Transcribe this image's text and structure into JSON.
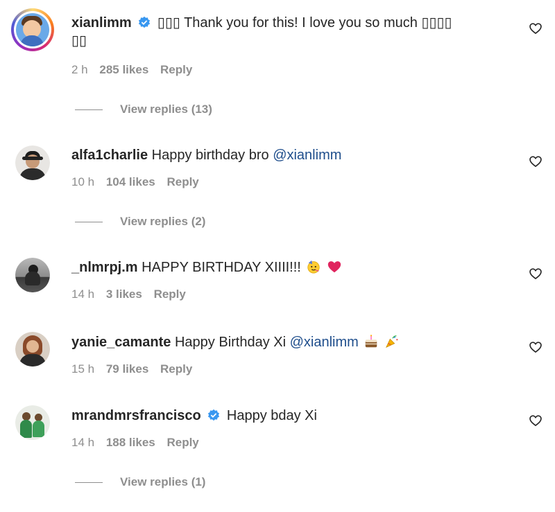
{
  "comments": [
    {
      "username": "xianlimm",
      "verified": true,
      "text": "Thank you for this! I love you so much",
      "leading_glyphs": "▯▯▯",
      "trailing_glyphs": "▯▯▯▯",
      "trailing_line2": "▯▯",
      "time": "2 h",
      "likes": "285 likes",
      "reply": "Reply",
      "view_replies": "View replies (13)"
    },
    {
      "username": "alfa1charlie",
      "text": "Happy birthday bro",
      "mention": "@xianlimm",
      "time": "10 h",
      "likes": "104 likes",
      "reply": "Reply",
      "view_replies": "View replies (2)"
    },
    {
      "username": "_nlmrpj.m",
      "text": "HAPPY BIRTHDAY XIIII!!!",
      "emojis": [
        "partying-face-emoji",
        "red-heart-emoji"
      ],
      "time": "14 h",
      "likes": "3 likes",
      "reply": "Reply"
    },
    {
      "username": "yanie_camante",
      "text": "Happy Birthday Xi",
      "mention": "@xianlimm",
      "emojis": [
        "cake-emoji",
        "party-popper-emoji"
      ],
      "time": "15 h",
      "likes": "79 likes",
      "reply": "Reply"
    },
    {
      "username": "mrandmrsfrancisco",
      "verified": true,
      "text": "Happy bday Xi",
      "time": "14 h",
      "likes": "188 likes",
      "reply": "Reply",
      "view_replies": "View replies (1)"
    }
  ],
  "colors": {
    "text": "#262626",
    "muted": "#8e8e8e",
    "mention": "#1f4e8c",
    "verified": "#3897f0"
  }
}
